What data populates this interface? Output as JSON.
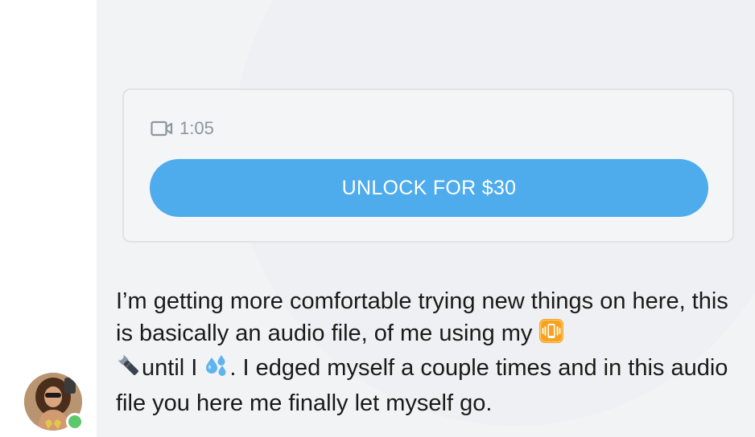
{
  "locked_media": {
    "duration": "1:05",
    "media_icon": "video-camera-icon",
    "unlock_label": "UNLOCK FOR $30"
  },
  "message": {
    "part1": "I’m getting more comfortable trying new things on here, this is basically an audio file, of me using my ",
    "emoji1": "vibration-mode-emoji",
    "emoji2": "flashlight-emoji",
    "part2": "until I ",
    "emoji3": "sweat-droplets-emoji",
    "part3": ". I edged myself a couple times and in this audio file you here me finally let myself go."
  },
  "sender": {
    "avatar_icon": "avatar-photo",
    "online": true
  },
  "colors": {
    "accent": "#4eacec",
    "bubble_bg": "#f2f3f5",
    "online": "#5cc86a",
    "muted_text": "#8a96a3"
  }
}
